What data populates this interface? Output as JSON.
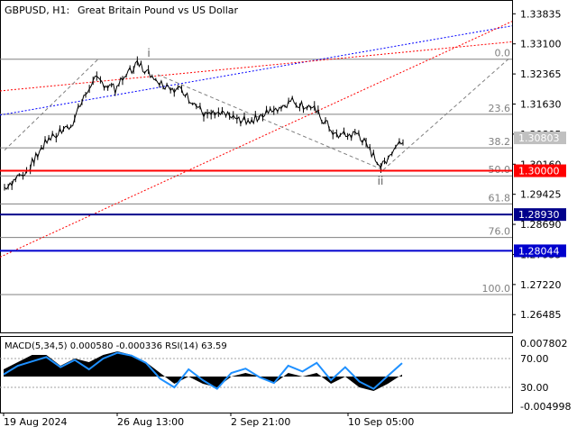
{
  "header": {
    "symbol_tf": "GBPUSD, H1:",
    "description": "Great Britain Pound vs US Dollar"
  },
  "chart_data": [
    {
      "type": "candlestick",
      "title": "GBPUSD, H1:  Great Britain Pound vs US Dollar",
      "y_ticks": [
        "1.33835",
        "1.33100",
        "1.32365",
        "1.31630",
        "1.30895",
        "1.30160",
        "1.29425",
        "1.28690",
        "1.27955",
        "1.27220",
        "1.26485"
      ],
      "y_tick_values": [
        1.33835,
        1.331,
        1.32365,
        1.3163,
        1.30895,
        1.3016,
        1.29425,
        1.2869,
        1.27955,
        1.2722,
        1.26485
      ],
      "ylim": [
        1.2605,
        1.3415
      ],
      "x_ticks": [
        "19 Aug 2024",
        "26 Aug 13:00",
        "2 Sep 21:00",
        "10 Sep 05:00"
      ],
      "price_tags": [
        {
          "value": 1.30803,
          "label": "1.30803",
          "kind": "current",
          "color": "#c0c0c0"
        },
        {
          "value": 1.3,
          "label": "1.30000",
          "kind": "level",
          "color": "#ff0000"
        },
        {
          "value": 1.2893,
          "label": "1.28930",
          "kind": "level",
          "color": "#00008b"
        },
        {
          "value": 1.28044,
          "label": "1.28044",
          "kind": "level",
          "color": "#0000cd"
        }
      ],
      "fibonacci": {
        "levels": [
          {
            "label": "0.0",
            "value": 1.32725
          },
          {
            "label": "23.6",
            "value": 1.3138
          },
          {
            "label": "38.2",
            "value": 1.3056
          },
          {
            "label": "50.0",
            "value": 1.29875
          },
          {
            "label": "61.8",
            "value": 1.2919
          },
          {
            "label": "76.0",
            "value": 1.2837
          },
          {
            "label": "100.0",
            "value": 1.26975
          }
        ]
      },
      "wave_labels": [
        {
          "label": "i",
          "date": "27 Aug 2024",
          "value": 1.3275
        },
        {
          "label": "ii",
          "date": "11 Sep 2024",
          "value": 1.3002
        }
      ],
      "horizontal_lines": [
        {
          "value": 1.3,
          "color": "#ff0000"
        },
        {
          "value": 1.2893,
          "color": "#00008b"
        },
        {
          "value": 1.28044,
          "color": "#0000cd"
        }
      ],
      "price_path": [
        {
          "date": "19 Aug",
          "value": 1.296
        },
        {
          "date": "20 Aug",
          "value": 1.3
        },
        {
          "date": "21 Aug",
          "value": 1.308
        },
        {
          "date": "22 Aug",
          "value": 1.311
        },
        {
          "date": "23 Aug",
          "value": 1.3225
        },
        {
          "date": "26 Aug",
          "value": 1.32
        },
        {
          "date": "27 Aug",
          "value": 1.3265
        },
        {
          "date": "28 Aug",
          "value": 1.3215
        },
        {
          "date": "29 Aug",
          "value": 1.3195
        },
        {
          "date": "30 Aug",
          "value": 1.314
        },
        {
          "date": "2 Sep",
          "value": 1.3135
        },
        {
          "date": "3 Sep",
          "value": 1.312
        },
        {
          "date": "4 Sep",
          "value": 1.3145
        },
        {
          "date": "5 Sep",
          "value": 1.317
        },
        {
          "date": "6 Sep",
          "value": 1.315
        },
        {
          "date": "9 Sep",
          "value": 1.3085
        },
        {
          "date": "10 Sep",
          "value": 1.309
        },
        {
          "date": "11 Sep",
          "value": 1.301
        },
        {
          "date": "12 Sep",
          "value": 1.308
        }
      ]
    },
    {
      "type": "area",
      "title": "MACD(5,34,5) 0.000580 -0.000336 RSI(14) 63.59",
      "y_ticks": [
        "0.007802",
        "70.00",
        "30.00",
        "-0.004998"
      ],
      "rsi_levels": [
        70,
        30
      ],
      "series": [
        {
          "name": "RSI(14)",
          "color": "#1e90ff",
          "values": [
            48,
            60,
            66,
            72,
            58,
            68,
            55,
            70,
            78,
            74,
            64,
            42,
            30,
            55,
            40,
            28,
            50,
            56,
            44,
            36,
            60,
            52,
            64,
            40,
            58,
            38,
            28,
            46,
            63.59
          ]
        },
        {
          "name": "MACD",
          "color": "#000000",
          "values": [
            0.002,
            0.004,
            0.006,
            0.006,
            0.003,
            0.005,
            0.004,
            0.006,
            0.007,
            0.006,
            0.004,
            0.001,
            -0.002,
            0.0,
            -0.002,
            -0.003,
            0.0,
            0.001,
            0.0,
            -0.002,
            0.001,
            0.0,
            0.001,
            -0.002,
            0.0,
            -0.003,
            -0.004,
            -0.002,
            0.00058
          ]
        }
      ]
    }
  ]
}
